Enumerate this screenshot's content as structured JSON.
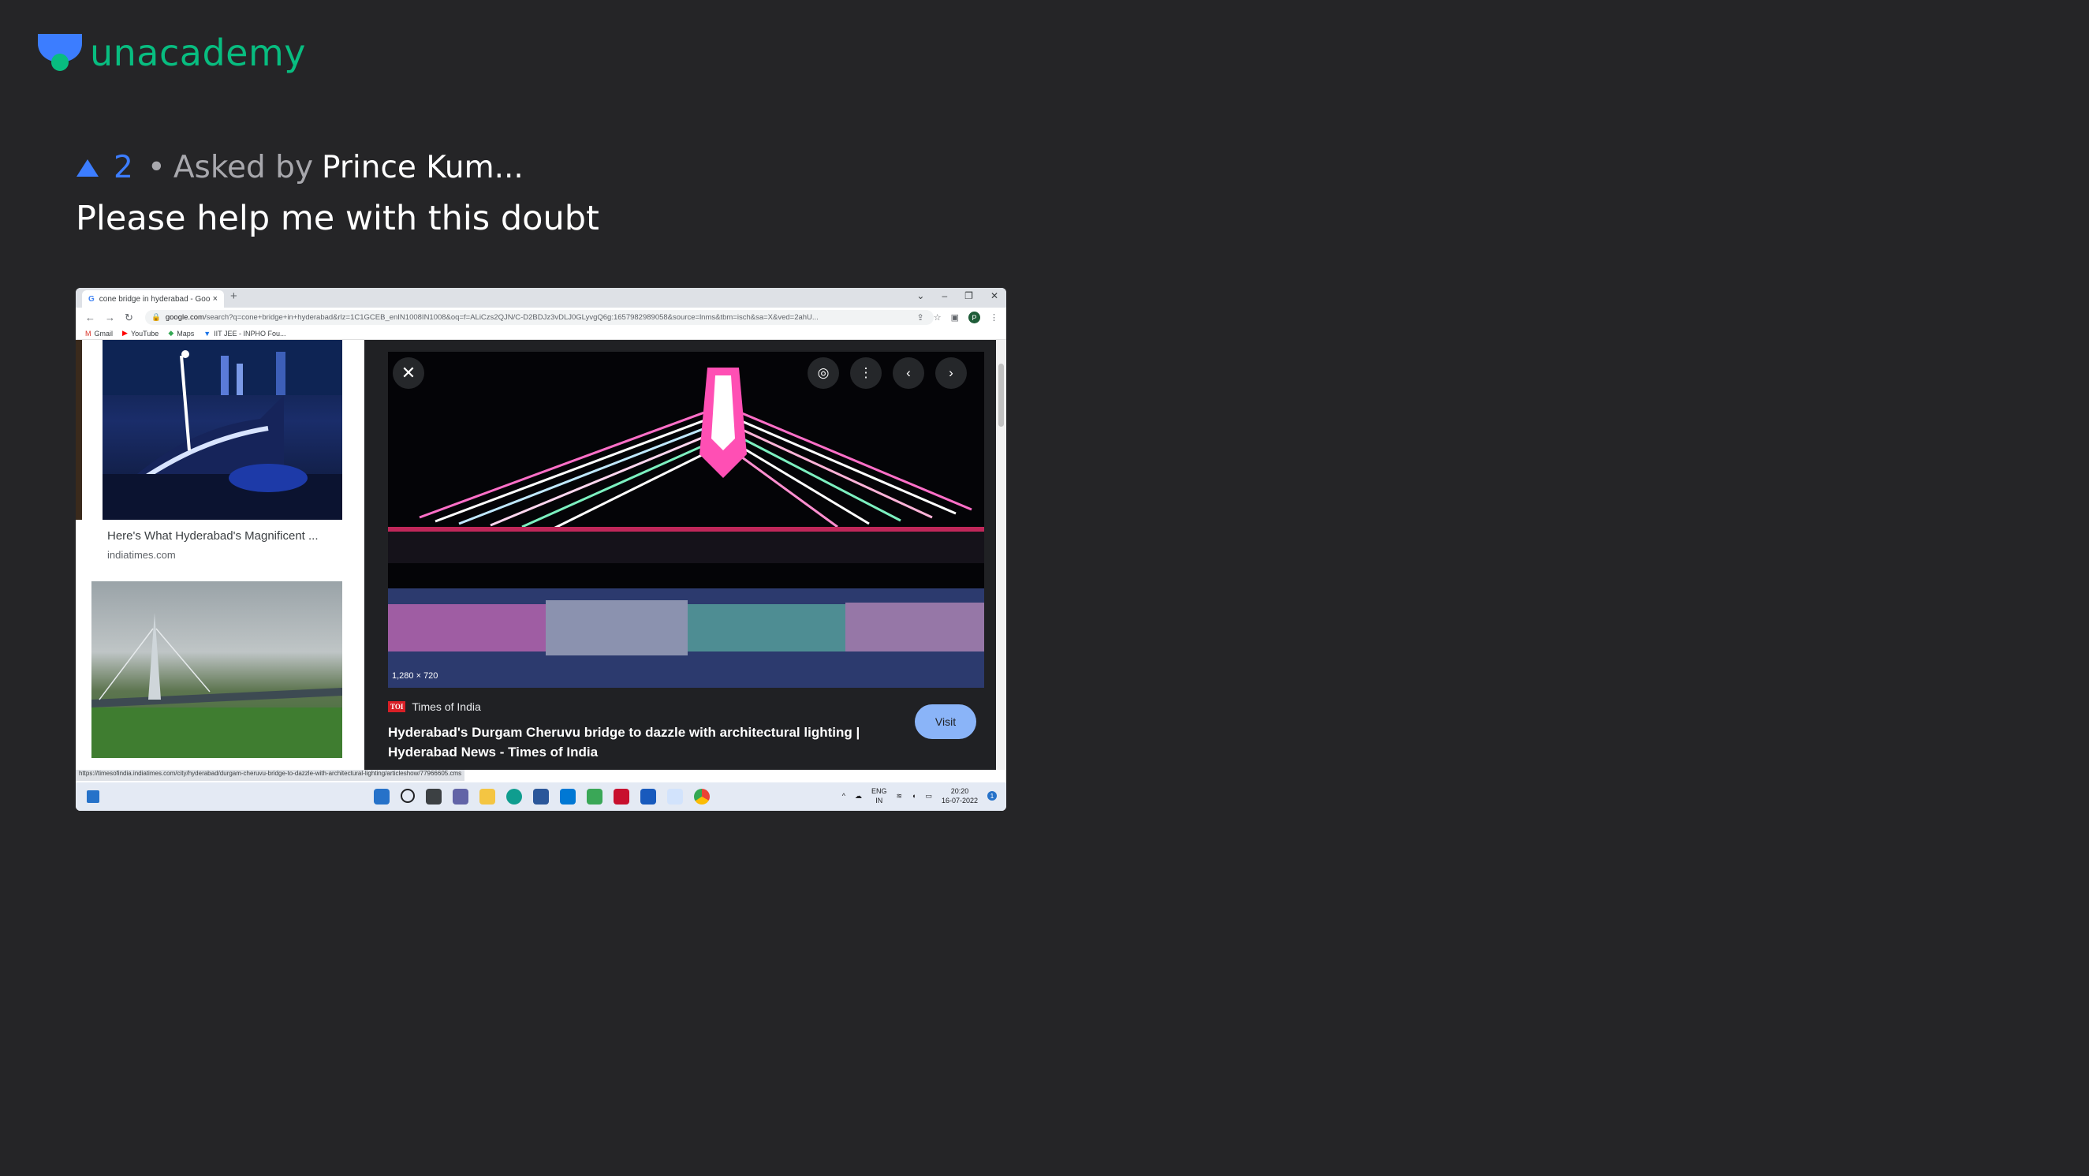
{
  "brand": {
    "name": "unacademy",
    "logo_icon": "unacademy-logo-icon",
    "color": "#08bd80"
  },
  "question": {
    "upvote_icon": "upvote-triangle-icon",
    "upvotes": "2",
    "separator": "•",
    "asked_by_label": "Asked by",
    "asker": "Prince Kum...",
    "title": "Please help me with this doubt"
  },
  "attachment": {
    "browser": {
      "tab_title": "cone bridge in hyderabad - Goo",
      "tab_close": "×",
      "new_tab": "+",
      "url_host": "google.com",
      "url_path": "/search?q=cone+bridge+in+hyderabad&rlz=1C1GCEB_enIN1008IN1008&oq=f=ALiCzs2QJN/C-D2BDJz3vDLJ0GLyvgQ6g:1657982989058&source=lnms&tbm=isch&sa=X&ved=2ahU...",
      "bookmarks": [
        {
          "label": "Gmail",
          "icon": "gmail-icon"
        },
        {
          "label": "YouTube",
          "icon": "youtube-icon"
        },
        {
          "label": "Maps",
          "icon": "maps-icon"
        },
        {
          "label": "IIT JEE - INPHO Fou...",
          "icon": "bookmark-icon"
        }
      ]
    },
    "results": [
      {
        "caption": "Here's What Hyderabad's Magnificent ...",
        "source": "indiatimes.com"
      }
    ],
    "viewer": {
      "image_dims": "1,280 × 720",
      "source_name": "Times of India",
      "source_badge": "TOI",
      "title": "Hyderabad's Durgam Cheruvu bridge to dazzle with architectural lighting | Hyderabad News - Times of India",
      "visit_label": "Visit"
    },
    "status_url": "https://timesofindia.indiatimes.com/city/hyderabad/durgam-cheruvu-bridge-to-dazzle-with-architectural-lighting/articleshow/77966605.cms",
    "taskbar": {
      "lang_top": "ENG",
      "lang_bottom": "IN",
      "time": "20:20",
      "date": "16-07-2022",
      "notification_count": "1"
    }
  }
}
